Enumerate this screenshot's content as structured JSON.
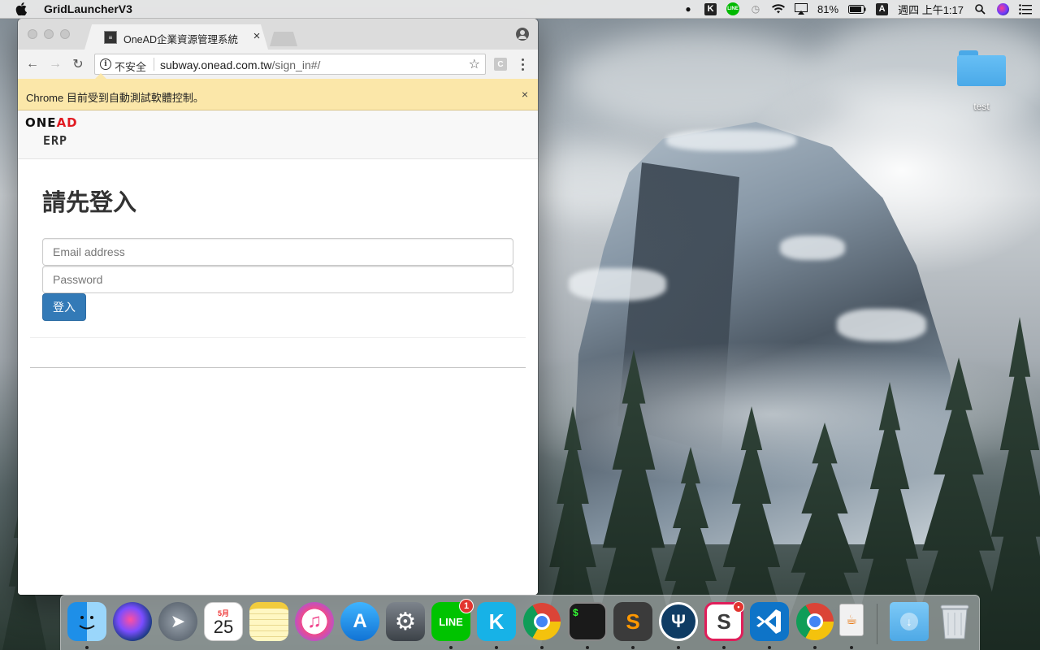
{
  "menubar": {
    "app_name": "GridLauncherV3",
    "battery": "81%",
    "input_source": "A",
    "clock": "週四 上午1:17",
    "line_label": "LINE"
  },
  "desktop": {
    "folder_label": "test"
  },
  "browser": {
    "tab_title": "OneAD企業資源管理系統",
    "tab_close": "×",
    "security_label": "不安全",
    "url_host": "subway.onead.com.tw",
    "url_path": "/sign_in#/",
    "extension_label": "C",
    "infobar_text": "Chrome 目前受到自動測試軟體控制。",
    "infobar_close": "×"
  },
  "page": {
    "logo_text_one": "ONE",
    "logo_text_ad": "AD",
    "logo_sub": "ERP",
    "heading": "請先登入",
    "email_placeholder": "Email address",
    "password_placeholder": "Password",
    "login_label": "登入"
  },
  "dock": {
    "items": [
      {
        "name": "Finder"
      },
      {
        "name": "Siri"
      },
      {
        "name": "Launchpad"
      },
      {
        "name": "Calendar",
        "month": "5月",
        "day": "25"
      },
      {
        "name": "Notes"
      },
      {
        "name": "iTunes"
      },
      {
        "name": "App Store"
      },
      {
        "name": "System Preferences"
      },
      {
        "name": "LINE",
        "label": "LINE",
        "badge": "1"
      },
      {
        "name": "Kodi",
        "label": "K"
      },
      {
        "name": "Google Chrome"
      },
      {
        "name": "Terminal",
        "label": "$"
      },
      {
        "name": "Sublime Text",
        "label": "S"
      },
      {
        "name": "SourceTree"
      },
      {
        "name": "Slack",
        "label": "S"
      },
      {
        "name": "Visual Studio Code"
      },
      {
        "name": "Google Chrome 2"
      },
      {
        "name": "Java"
      },
      {
        "name": "Downloads"
      },
      {
        "name": "Trash"
      }
    ]
  },
  "colors": {
    "primary_button": "#337ab7",
    "infobar_bg": "#fbe7a9",
    "logo_red": "#e11b22"
  }
}
